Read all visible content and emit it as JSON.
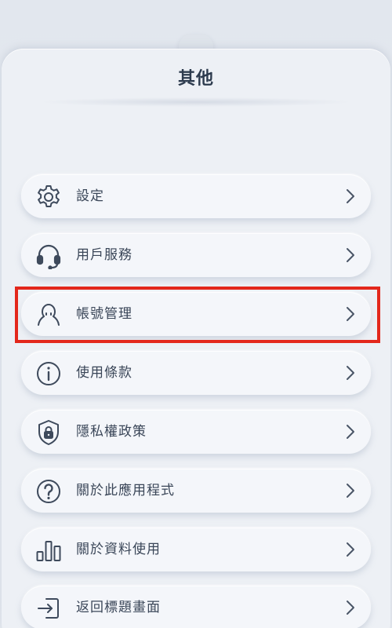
{
  "header": {
    "title": "其他"
  },
  "menu": {
    "items": [
      {
        "label": "設定",
        "icon": "gear-icon"
      },
      {
        "label": "用戶服務",
        "icon": "headset-icon"
      },
      {
        "label": "帳號管理",
        "icon": "user-icon"
      },
      {
        "label": "使用條款",
        "icon": "info-icon"
      },
      {
        "label": "隱私權政策",
        "icon": "shield-lock-icon"
      },
      {
        "label": "關於此應用程式",
        "icon": "question-icon"
      },
      {
        "label": "關於資料使用",
        "icon": "bar-chart-icon"
      },
      {
        "label": "返回標題畫面",
        "icon": "sign-in-icon"
      }
    ],
    "highlighted_item": "帳號管理"
  },
  "colors": {
    "icon": "#3e4a5c",
    "text": "#3a4658",
    "highlight": "#e3271b",
    "background": "#e4e9f0"
  }
}
